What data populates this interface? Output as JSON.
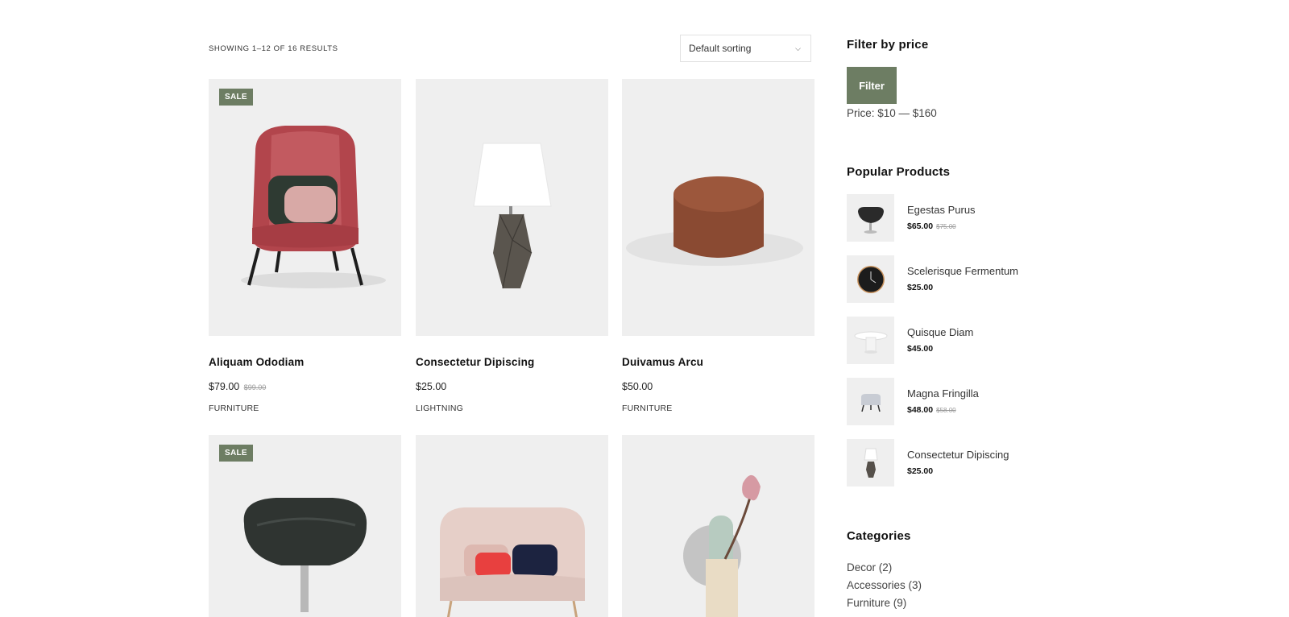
{
  "toolbar": {
    "results_count": "SHOWING 1–12 OF 16 RESULTS",
    "sort_value": "Default sorting"
  },
  "products": [
    {
      "title": "Aliquam Ododiam",
      "price": "$79.00",
      "old_price": "$99.00",
      "category": "FURNITURE",
      "badge": "SALE",
      "image": "red-lounge-chair-image"
    },
    {
      "title": "Consectetur Dipiscing",
      "price": "$25.00",
      "old_price": "",
      "category": "LIGHTNING",
      "badge": "",
      "image": "marble-table-lamp-image"
    },
    {
      "title": "Duivamus Arcu",
      "price": "$50.00",
      "old_price": "",
      "category": "FURNITURE",
      "badge": "",
      "image": "brown-pouf-image"
    },
    {
      "title": "",
      "price": "",
      "old_price": "",
      "category": "",
      "badge": "SALE",
      "image": "black-swivel-chair-image"
    },
    {
      "title": "",
      "price": "",
      "old_price": "",
      "category": "",
      "badge": "",
      "image": "pink-loveseat-image"
    },
    {
      "title": "",
      "price": "",
      "old_price": "",
      "category": "",
      "badge": "",
      "image": "vase-with-flower-image"
    }
  ],
  "sidebar": {
    "filter": {
      "title": "Filter by price",
      "button_label": "Filter",
      "price_label": "Price: $10 — $160"
    },
    "popular": {
      "title": "Popular Products",
      "items": [
        {
          "name": "Egestas Purus",
          "price": "$65.00",
          "old_price": "$75.00",
          "image": "black-egg-chair-thumb"
        },
        {
          "name": "Scelerisque Fermentum",
          "price": "$25.00",
          "old_price": "",
          "image": "wall-clock-thumb"
        },
        {
          "name": "Quisque Diam",
          "price": "$45.00",
          "old_price": "",
          "image": "round-side-table-thumb"
        },
        {
          "name": "Magna Fringilla",
          "price": "$48.00",
          "old_price": "$58.00",
          "image": "gray-stool-thumb"
        },
        {
          "name": "Consectetur Dipiscing",
          "price": "$25.00",
          "old_price": "",
          "image": "table-lamp-thumb"
        }
      ]
    },
    "categories": {
      "title": "Categories",
      "items": [
        "Decor (2)",
        "Accessories (3)",
        "Furniture (9)"
      ]
    }
  },
  "colors": {
    "accent": "#6d7d63",
    "card_bg": "#efefef",
    "text_dark": "#111111"
  }
}
